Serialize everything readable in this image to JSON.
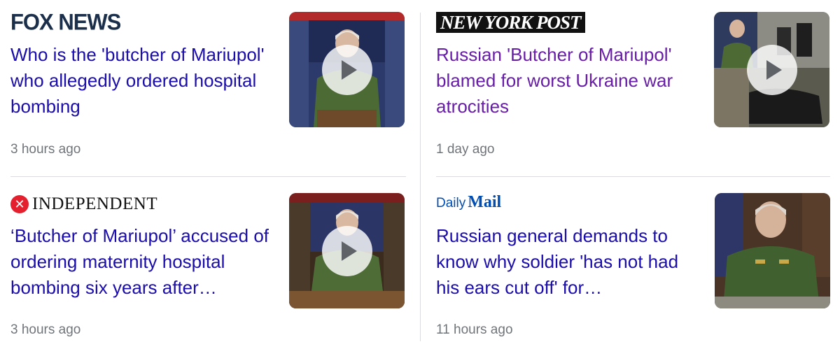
{
  "cards": [
    {
      "source": "FOX NEWS",
      "logo_icon": "fox-news-logo",
      "headline": "Who is the 'butcher of Mariupol' who allegedly ordered hospital bombing",
      "time": "3 hours ago",
      "thumbnail": "video-thumbnail",
      "has_video": true
    },
    {
      "source": "NEW YORK POST",
      "logo_icon": "new-york-post-logo",
      "headline": "Russian 'Butcher of Mariupol' blamed for worst Ukraine war atrocities",
      "time": "1 day ago",
      "thumbnail": "video-thumbnail",
      "has_video": true,
      "visited": true
    },
    {
      "source": "INDEPENDENT",
      "logo_icon": "independent-logo",
      "headline": "‘Butcher of Mariupol’ accused of ordering maternity hospital bombing six years after…",
      "time": "3 hours ago",
      "thumbnail": "video-thumbnail",
      "has_video": true
    },
    {
      "source_part1": "Daily",
      "source_part2": "Mail",
      "logo_icon": "daily-mail-logo",
      "headline": "Russian general demands to know why soldier 'has not had his ears cut off' for…",
      "time": "11 hours ago",
      "thumbnail": "photo-thumbnail",
      "has_video": false
    }
  ],
  "colors": {
    "link": "#1a0dab",
    "visited_link": "#681da8",
    "timestamp": "#70757a",
    "divider": "#dadce0"
  }
}
